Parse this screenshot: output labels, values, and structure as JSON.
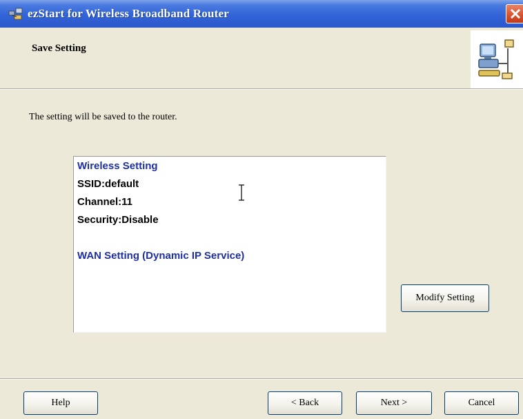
{
  "window": {
    "title": "ezStart for Wireless Broadband Router"
  },
  "header": {
    "title": "Save Setting"
  },
  "main": {
    "intro": "The setting will be saved to the router.",
    "summary": {
      "wireless_heading": "Wireless Setting",
      "ssid": "SSID:default",
      "channel": "Channel:11",
      "security": "Security:Disable",
      "wan_heading": "WAN Setting  (Dynamic IP Service)"
    },
    "modify_button": "Modify Setting"
  },
  "footer": {
    "help": "Help",
    "back": "< Back",
    "next": "Next >",
    "cancel": "Cancel"
  },
  "colors": {
    "titlebar": "#3263d8",
    "accent_text": "#1c2fa8",
    "dialog_bg": "#ece9d8",
    "close_button": "#d6512e"
  },
  "icons": [
    "app-icon",
    "close-icon",
    "network-wizard-icon",
    "text-cursor-icon"
  ]
}
